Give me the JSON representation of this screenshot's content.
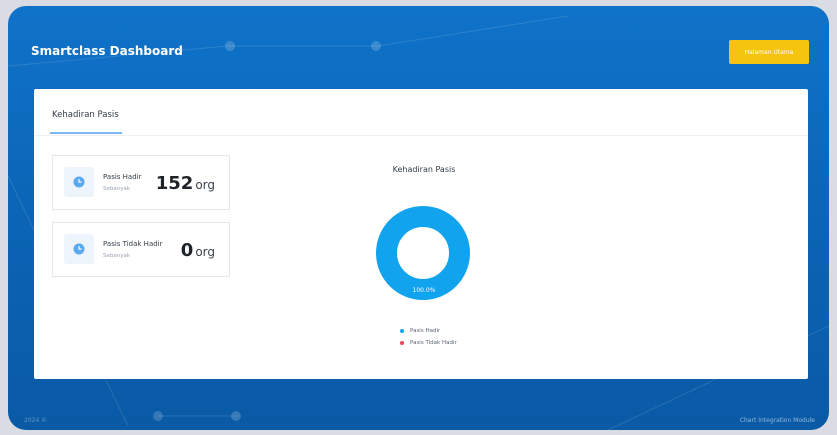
{
  "header": {
    "brand": "Smartclass Dashboard",
    "home_button_label": "Halaman Utama"
  },
  "card": {
    "tab_label": "Kehadiran Pasis"
  },
  "stats": [
    {
      "label": "Pasis Hadir",
      "sublabel": "Sebanyak",
      "value": "152",
      "unit": "org",
      "icon": "clock-icon"
    },
    {
      "label": "Pasis Tidak Hadir",
      "sublabel": "Sebanyak",
      "value": "0",
      "unit": "org",
      "icon": "clock-icon"
    }
  ],
  "chart_data": {
    "type": "pie",
    "title": "Kehadiran Pasis",
    "categories": [
      "Pasis Hadir",
      "Pasis Tidak Hadir"
    ],
    "values": [
      152,
      0
    ],
    "colors": [
      "#12a3ef",
      "#f0445e"
    ],
    "data_labels": [
      "100.0%",
      ""
    ],
    "legend_position": "bottom"
  },
  "footer": {
    "left": "2024 ©",
    "right": "Chart Integration Module"
  },
  "colors": {
    "background": "#0f73c9",
    "accent_button": "#f5c40f",
    "card": "#ffffff"
  }
}
